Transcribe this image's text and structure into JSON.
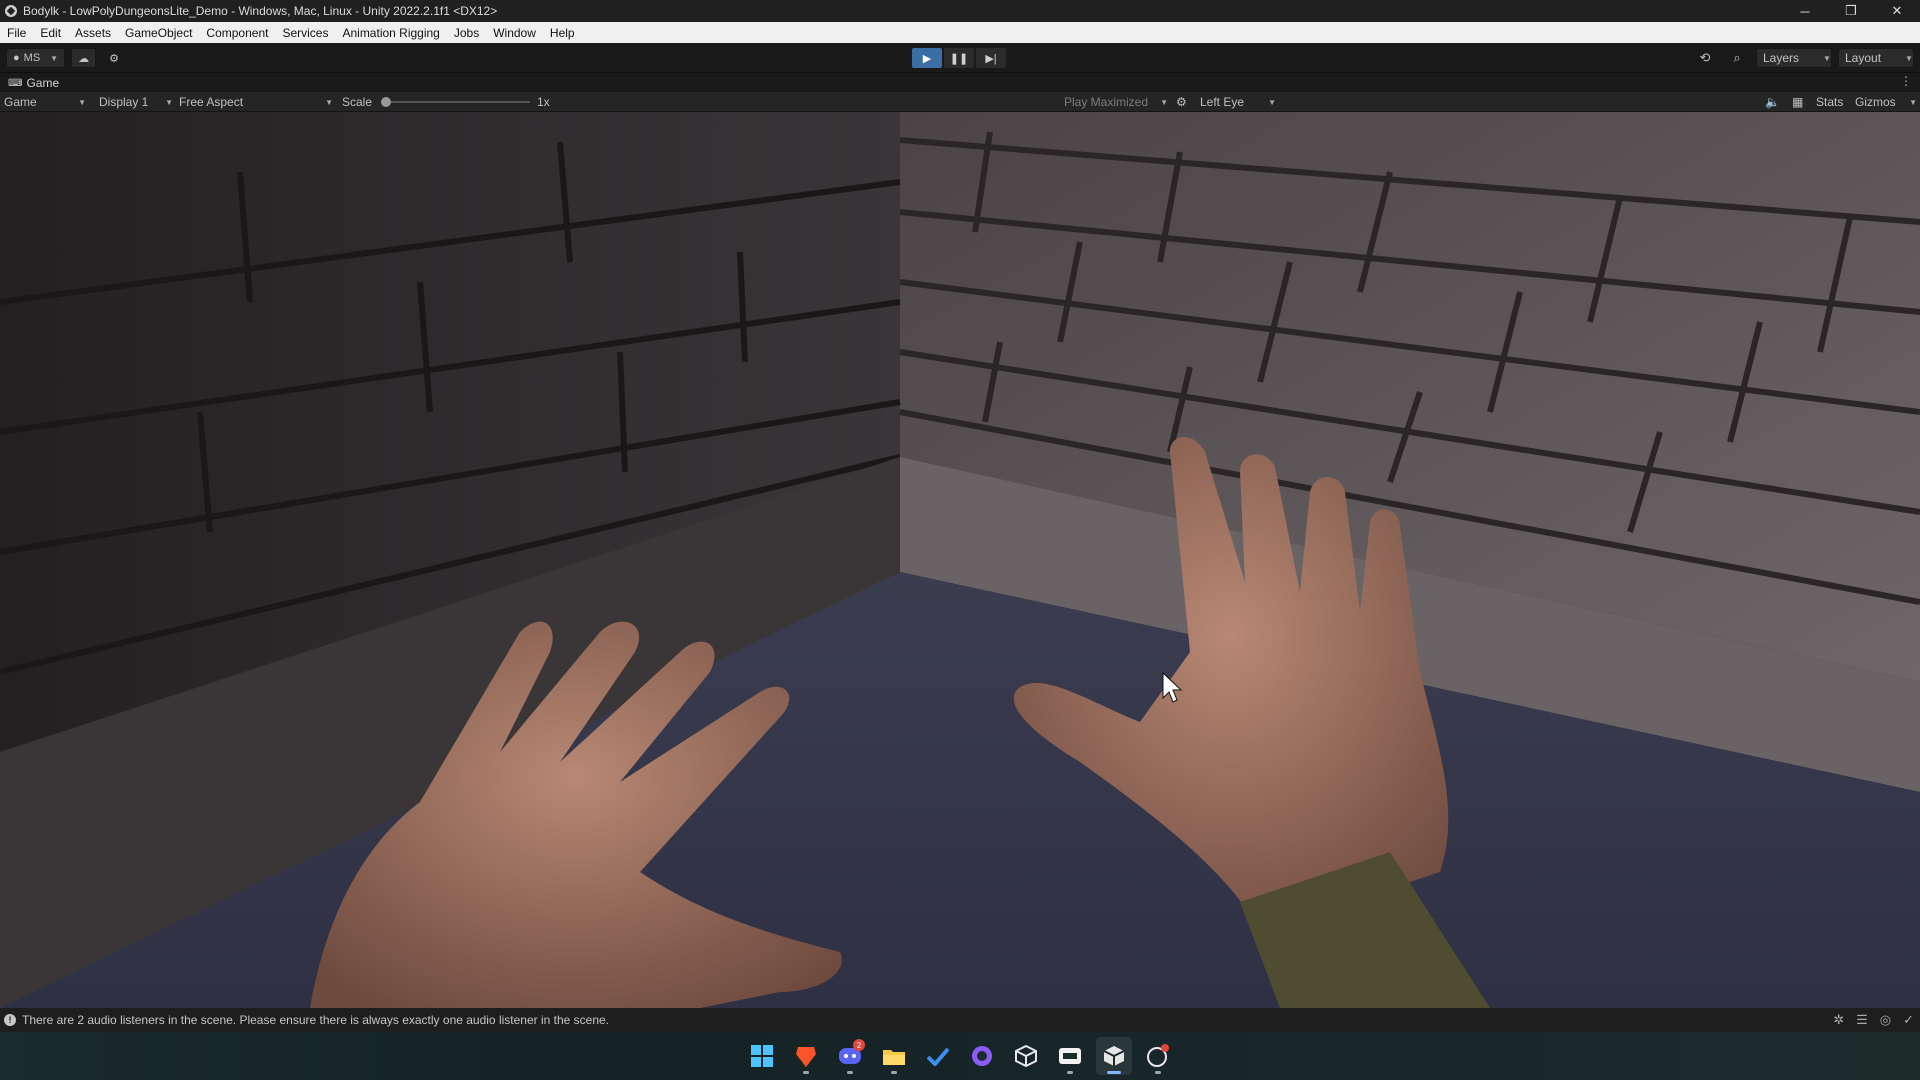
{
  "window": {
    "title": "Bodylk - LowPolyDungeonsLite_Demo - Windows, Mac, Linux - Unity 2022.2.1f1 <DX12>",
    "controls": {
      "minimize": "─",
      "restore": "❐",
      "close": "✕"
    }
  },
  "menu": [
    "File",
    "Edit",
    "Assets",
    "GameObject",
    "Component",
    "Services",
    "Animation Rigging",
    "Jobs",
    "Window",
    "Help"
  ],
  "toolbar": {
    "account_label": "MS",
    "layers_label": "Layers",
    "layout_label": "Layout",
    "play_active": true
  },
  "tab": {
    "label": "Game"
  },
  "gamebar": {
    "mode": "Game",
    "display": "Display 1",
    "aspect": "Free Aspect",
    "scale_label": "Scale",
    "scale_value": "1x",
    "play_mode": "Play Maximized",
    "eye": "Left Eye",
    "stats_label": "Stats",
    "gizmos_label": "Gizmos"
  },
  "status": {
    "message": "There are 2 audio listeners in the scene. Please ensure there is always exactly one audio listener in the scene."
  },
  "taskbar": {
    "icons": [
      "windows-start",
      "brave-browser",
      "discord",
      "file-explorer",
      "todo",
      "github-desktop",
      "unity-hub",
      "obsidian",
      "unity-editor",
      "app-notification"
    ],
    "discord_badge": "2"
  },
  "colors": {
    "play_active": "#3a6ea5",
    "brave": "#fb542b",
    "discord": "#5865f2",
    "github": "#8a5cf5"
  }
}
